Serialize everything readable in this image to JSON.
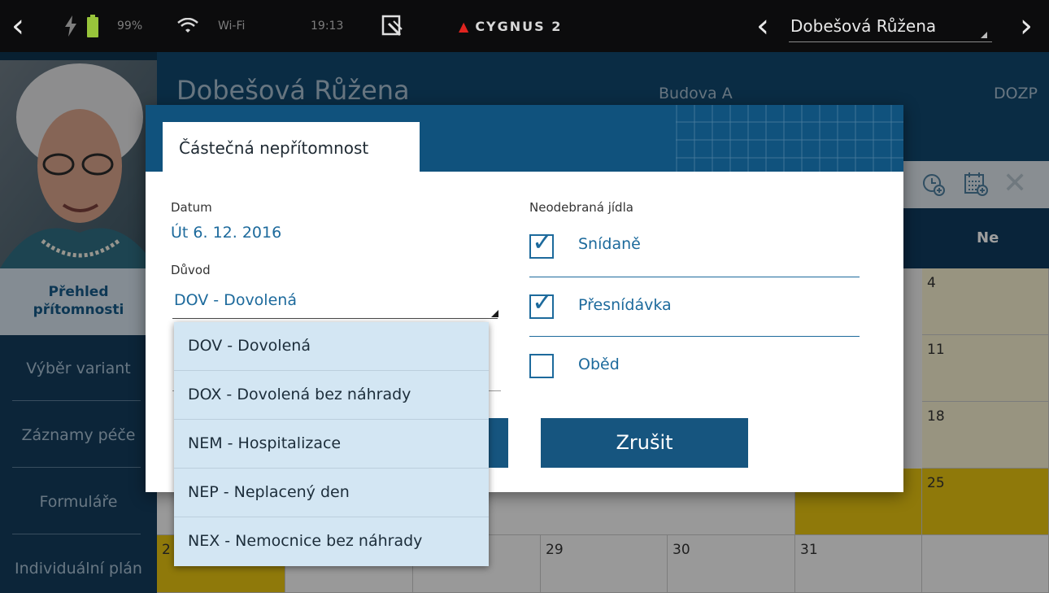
{
  "status_bar": {
    "battery": "99%",
    "wifi_label": "Wi-Fi",
    "time": "19:13",
    "logo": "CYGNUS 2",
    "patient_select": "Dobešová Růžena"
  },
  "header": {
    "patient_name": "Dobešová Růžena",
    "building": "Budova A",
    "unit": "DOZP"
  },
  "sidebar": {
    "items": [
      {
        "label": "Přehled přítomnosti",
        "line1": "Přehled",
        "line2": "přítomnosti",
        "active": true
      },
      {
        "label": "Výběr variant"
      },
      {
        "label": "Záznamy péče"
      },
      {
        "label": "Formuláře"
      },
      {
        "label": "Individuální plán"
      }
    ]
  },
  "calendar": {
    "visible_day_header": "Ne",
    "day_numbers": {
      "row1_ne": "4",
      "row2_ne": "11",
      "row3_ne": "18",
      "row4_ne": "25",
      "row5_mon_partial": "2",
      "row5_wed": "29",
      "row5_thu": "30",
      "row5_fri": "31"
    },
    "icons": [
      "clock-add-icon",
      "calendar-add-icon",
      "close-icon"
    ],
    "colors": {
      "highlight": "#e7c311",
      "cream": "#f5efcf"
    }
  },
  "dialog": {
    "tab_title": "Částečná nepřítomnost",
    "date_label": "Datum",
    "date_value": "Út 6. 12. 2016",
    "reason_label": "Důvod",
    "reason_value": "DOV - Dovolená",
    "meals_label": "Neodebraná jídla",
    "meals": [
      {
        "label": "Snídaně",
        "checked": true
      },
      {
        "label": "Přesnídávka",
        "checked": true
      },
      {
        "label": "Oběd",
        "checked": false
      }
    ],
    "cancel_button": "Zrušit"
  },
  "dropdown": {
    "options": [
      "DOV - Dovolená",
      "DOX - Dovolená bez náhrady",
      "NEM - Hospitalizace",
      "NEP - Neplacený den",
      "NEX - Nemocnice bez náhrady"
    ]
  }
}
